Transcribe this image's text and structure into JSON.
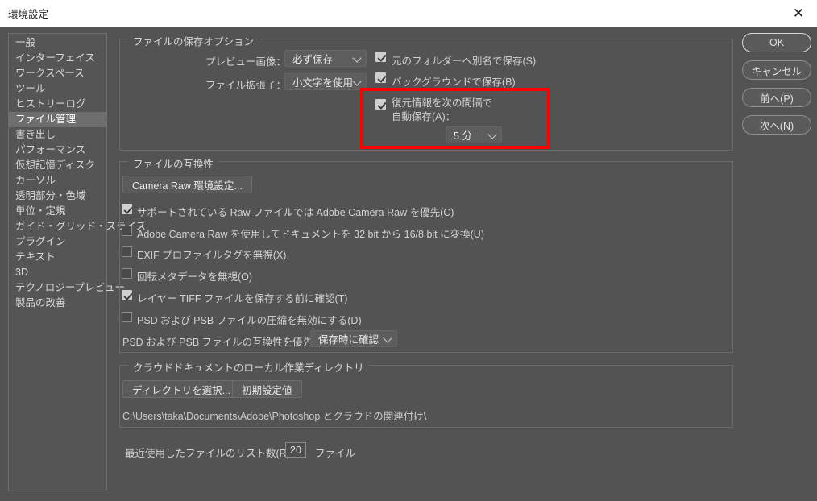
{
  "window": {
    "title": "環境設定",
    "close_icon": "close-icon"
  },
  "sidebar": {
    "items": [
      {
        "label": "一般",
        "selected": false
      },
      {
        "label": "インターフェイス",
        "selected": false
      },
      {
        "label": "ワークスペース",
        "selected": false
      },
      {
        "label": "ツール",
        "selected": false
      },
      {
        "label": "ヒストリーログ",
        "selected": false
      },
      {
        "label": "ファイル管理",
        "selected": true
      },
      {
        "label": "書き出し",
        "selected": false
      },
      {
        "label": "パフォーマンス",
        "selected": false
      },
      {
        "label": "仮想記憶ディスク",
        "selected": false
      },
      {
        "label": "カーソル",
        "selected": false
      },
      {
        "label": "透明部分・色域",
        "selected": false
      },
      {
        "label": "単位・定規",
        "selected": false
      },
      {
        "label": "ガイド・グリッド・スライス",
        "selected": false
      },
      {
        "label": "プラグイン",
        "selected": false
      },
      {
        "label": "テキスト",
        "selected": false
      },
      {
        "label": "3D",
        "selected": false
      },
      {
        "label": "テクノロジープレビュー",
        "selected": false
      },
      {
        "label": "製品の改善",
        "selected": false
      }
    ]
  },
  "buttons": {
    "ok": "OK",
    "cancel": "キャンセル",
    "prev": "前へ(P)",
    "next": "次へ(N)"
  },
  "save_options": {
    "legend": "ファイルの保存オプション",
    "preview_label": "プレビュー画像：",
    "preview_value": "必ず保存",
    "extension_label": "ファイル拡張子：",
    "extension_value": "小文字を使用",
    "save_as_original_folder": "元のフォルダーへ別名で保存(S)",
    "save_in_background": "バックグラウンドで保存(B)",
    "autosave_line1": "復元情報を次の間隔で",
    "autosave_line2": "自動保存(A)：",
    "autosave_value": "5 分",
    "highlight_color": "#fe0000"
  },
  "compatibility": {
    "legend": "ファイルの互換性",
    "camera_raw_button": "Camera Raw 環境設定...",
    "prefer_camera_raw": "サポートされている Raw ファイルでは  Adobe Camera Raw を優先(C)",
    "convert_32bit": "Adobe Camera Raw を使用してドキュメントを 32 bit から 16/8 bit に変換(U)",
    "ignore_exif": "EXIF プロファイルタグを無視(X)",
    "ignore_rotation": "回転メタデータを無視(O)",
    "confirm_layered_tiff": "レイヤー TIFF ファイルを保存する前に確認(T)",
    "disable_compression": "PSD および PSB ファイルの圧縮を無効にする(D)",
    "maximize_label": "PSD および PSB ファイルの互換性を優先：",
    "maximize_value": "保存時に確認"
  },
  "cloud": {
    "legend": "クラウドドキュメントのローカル作業ディレクトリ",
    "choose_button": "ディレクトリを選択...",
    "default_button": "初期設定値",
    "path": "C:\\Users\\taka\\Documents\\Adobe\\Photoshop とクラウドの関連付け\\"
  },
  "recent": {
    "label": "最近使用したファイルのリスト数(R)：",
    "value": "20",
    "suffix": "ファイル"
  }
}
